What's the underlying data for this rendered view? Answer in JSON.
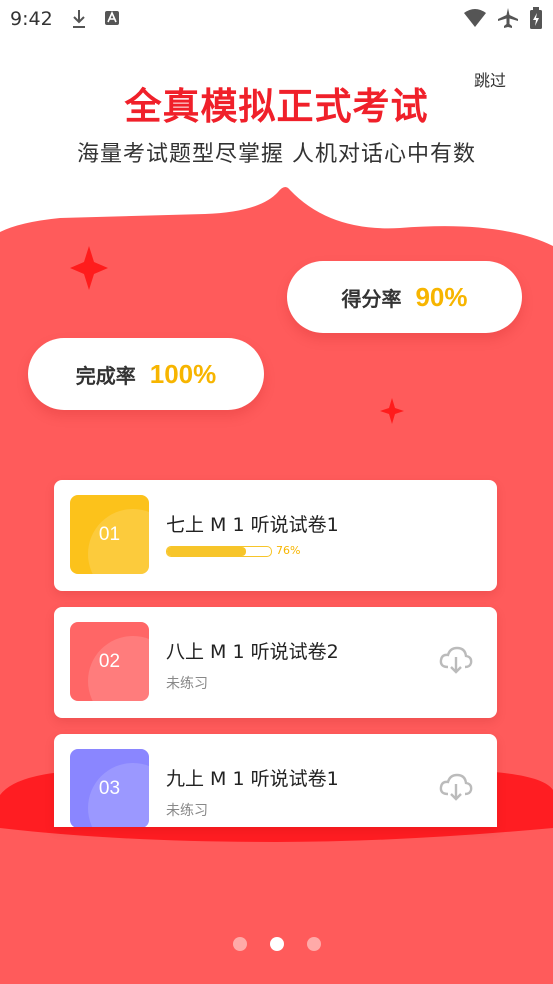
{
  "status_bar": {
    "time": "9:42"
  },
  "header": {
    "skip_label": "跳过",
    "title": "全真模拟正式考试",
    "subtitle": "海量考试题型尽掌握  人机对话心中有数"
  },
  "stats": [
    {
      "label": "得分率",
      "value": "90%"
    },
    {
      "label": "完成率",
      "value": "100%"
    }
  ],
  "cards": [
    {
      "number": "01",
      "title": "七上 M 1 听说试卷1",
      "progress_percent": 76,
      "progress_text": "76%",
      "color": "#fcc21b"
    },
    {
      "number": "02",
      "title": "八上 M 1 听说试卷2",
      "status": "未练习",
      "color": "#ff6666"
    },
    {
      "number": "03",
      "title": "九上 M 1 听说试卷1",
      "status": "未练习",
      "color": "#8a86ff"
    }
  ],
  "pager": {
    "count": 3,
    "active_index": 1
  },
  "colors": {
    "accent_red": "#f0202a",
    "background_red": "#ff5b5b",
    "score_yellow": "#f7b500"
  }
}
